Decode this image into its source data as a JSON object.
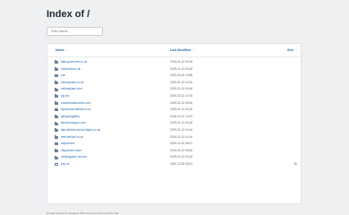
{
  "page": {
    "title": "Index of /"
  },
  "filter": {
    "placeholder": "Filter Name"
  },
  "table": {
    "headers": {
      "name": "Name",
      "modified": "Last Modified",
      "size": "Size",
      "sort_arrow": "↕"
    },
    "rows": [
      {
        "type": "folder",
        "name": "tattooyourcrew.co.uk",
        "modified": "2019-01-10 04:16",
        "size": ""
      },
      {
        "type": "folder",
        "name": "bunberart.co.uk",
        "modified": "2019-01-10 04:16",
        "size": ""
      },
      {
        "type": "folder",
        "name": "cdn",
        "modified": "2019-04-02 13:55",
        "size": ""
      },
      {
        "type": "folder",
        "name": "celtnaxplant.co.uk",
        "modified": "2019-01-10 04:16",
        "size": ""
      },
      {
        "type": "folder",
        "name": "celtnaxplant.com",
        "modified": "2019-01-10 04:16",
        "size": ""
      },
      {
        "type": "folder",
        "name": "cgi-bin",
        "modified": "2019-03-13 17:00",
        "size": ""
      },
      {
        "type": "folder",
        "name": "creativeartshowbiz.com",
        "modified": "2019-01-10 08:52",
        "size": ""
      },
      {
        "type": "folder",
        "name": "flysomeliondistrict.co.uk",
        "modified": "2019-01-10 04:16",
        "size": ""
      },
      {
        "type": "folder",
        "name": "glasgowgallery",
        "modified": "2018-10-31 14:07",
        "size": ""
      },
      {
        "type": "folder",
        "name": "kitchensmyyou.com",
        "modified": "2019-01-10 04:16",
        "size": ""
      },
      {
        "type": "folder",
        "name": "lake-district-scenic-flights.co.uk",
        "modified": "2019-01-10 04:16",
        "size": ""
      },
      {
        "type": "folder",
        "name": "metchellturf.co.uk",
        "modified": "2019-01-10 04:16",
        "size": ""
      },
      {
        "type": "folder",
        "name": "nefpachive",
        "modified": "2019-11-06 08:37",
        "size": ""
      },
      {
        "type": "folder",
        "name": "nefpachive.save",
        "modified": "2019-01-10 08:52",
        "size": ""
      },
      {
        "type": "folder",
        "name": "whitdogalore.uk.com",
        "modified": "2019-01-10 04:16",
        "size": ""
      },
      {
        "type": "file",
        "name": "php.ini",
        "modified": "2020-12-09 08:41",
        "size": "30"
      }
    ]
  },
  "footer": {
    "text": "Proudly Served by LiteSpeed Web Server at tensr.co.uk Port 443"
  },
  "colors": {
    "link": "#2b6cb0",
    "background": "#eef0f2",
    "panel": "#ffffff"
  }
}
